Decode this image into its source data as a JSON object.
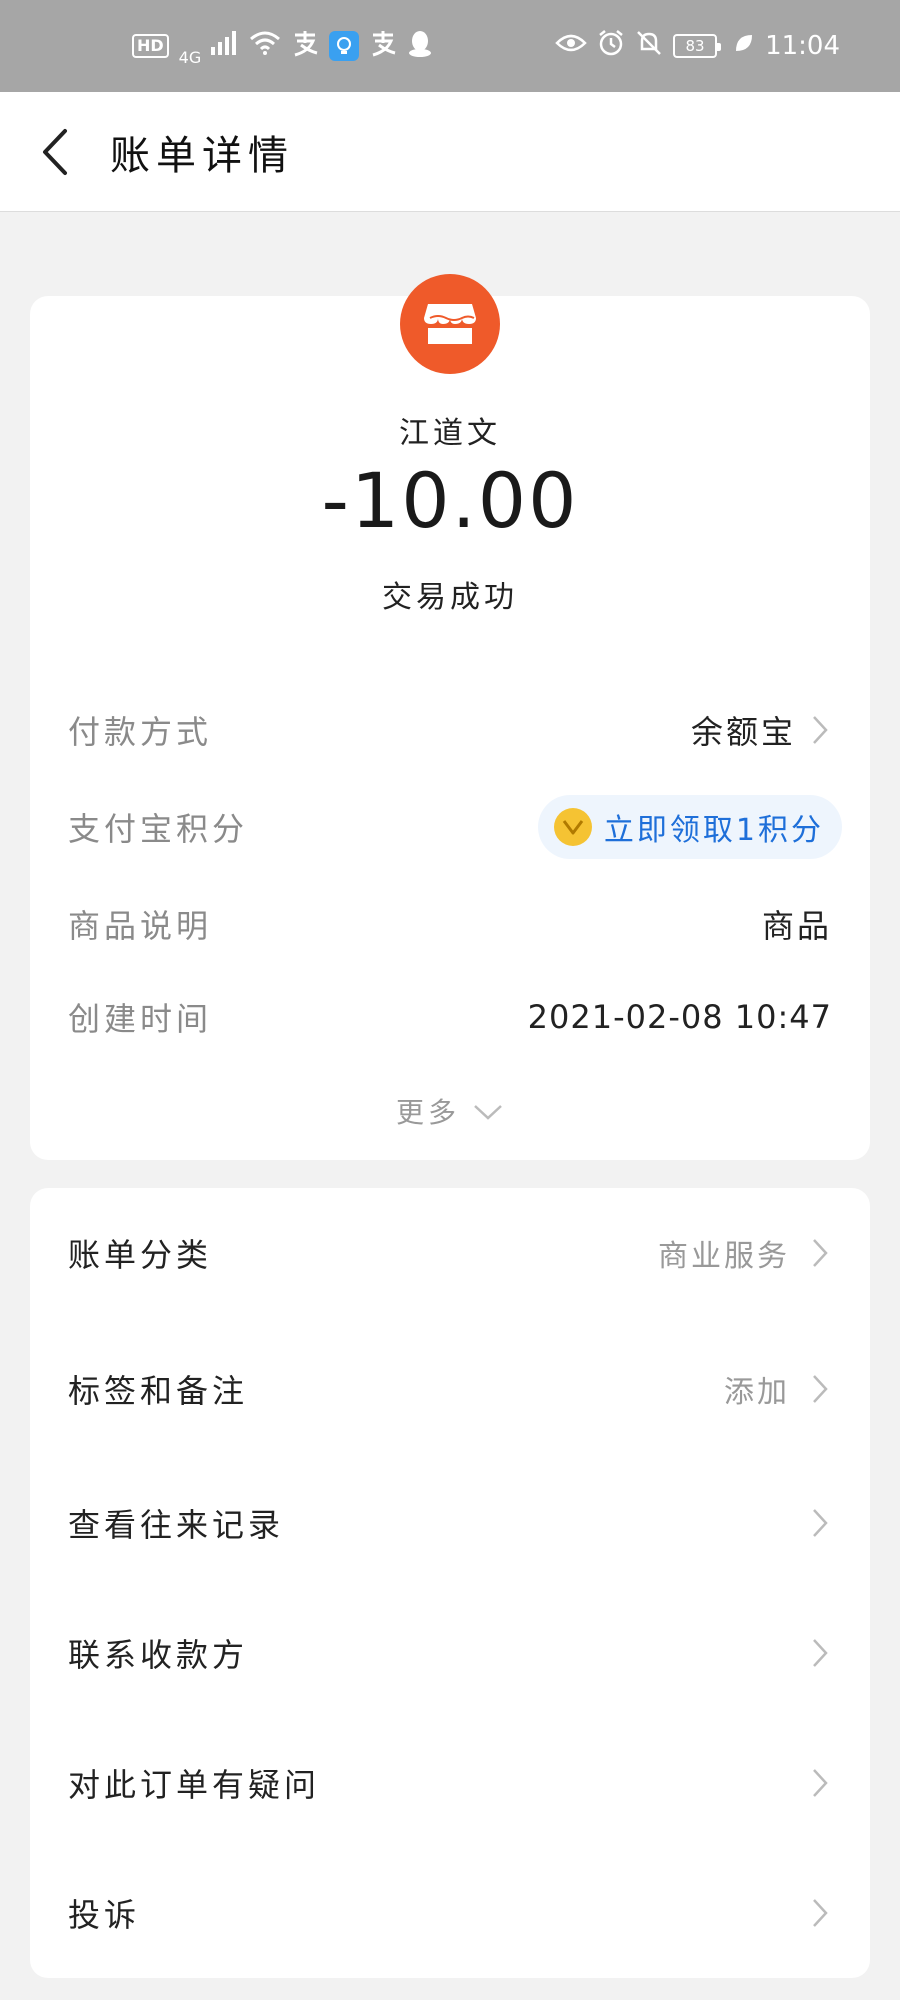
{
  "status_bar": {
    "hd": "HD",
    "network": "4G",
    "time": "11:04",
    "battery": "83"
  },
  "header": {
    "title": "账单详情"
  },
  "bill": {
    "merchant_name": "江道文",
    "amount": "-10.00",
    "status": "交易成功",
    "accent_color": "#ef5a2a"
  },
  "details": {
    "payment_method_label": "付款方式",
    "payment_method_value": "余额宝",
    "points_label": "支付宝积分",
    "points_value": "立即领取1积分",
    "goods_label": "商品说明",
    "goods_value": "商品",
    "created_label": "创建时间",
    "created_value": "2021-02-08 10:47",
    "more_label": "更多"
  },
  "actions": {
    "category_label": "账单分类",
    "category_value": "商业服务",
    "tags_label": "标签和备注",
    "tags_value": "添加",
    "records_label": "查看往来记录",
    "contact_label": "联系收款方",
    "question_label": "对此订单有疑问",
    "complain_label": "投诉"
  }
}
